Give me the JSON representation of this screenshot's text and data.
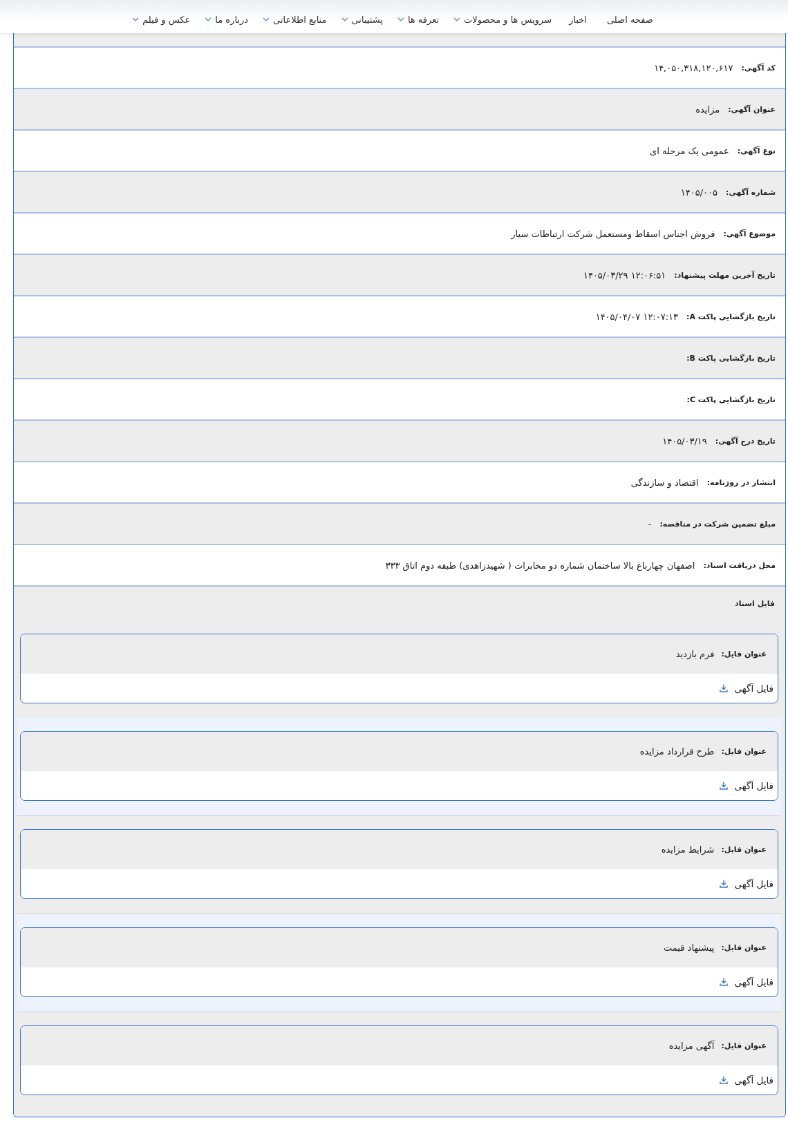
{
  "nav": {
    "items": [
      {
        "label": "صفحه اصلی",
        "kind": "link"
      },
      {
        "label": "اخبار",
        "kind": "link"
      },
      {
        "label": "سرویس ها و محصولات",
        "kind": "menu"
      },
      {
        "label": "تعرفه ها",
        "kind": "menu"
      },
      {
        "label": "پشتیبانی",
        "kind": "menu"
      },
      {
        "label": "منابع اطلاعاتی",
        "kind": "menu"
      },
      {
        "label": "درباره ما",
        "kind": "menu"
      },
      {
        "label": "عکس و فیلم",
        "kind": "menu"
      }
    ]
  },
  "details": {
    "rows": [
      {
        "label": "کد آگهی:",
        "value": "۱۴,۰۵۰,۳۱۸,۱۲۰,۶۱۷"
      },
      {
        "label": "عنوان آگهی:",
        "value": "مزایده"
      },
      {
        "label": "نوع آگهی:",
        "value": "عمومی یک مرحله ای"
      },
      {
        "label": "شماره آگهی:",
        "value": "۱۴۰۵/۰۰۵"
      },
      {
        "label": "موضوع آگهی:",
        "value": "فروش اجناس اسقاط ومستعمل شرکت ارتباطات سیار"
      },
      {
        "label": "تاریخ آخرین مهلت پیشنهاد:",
        "value": "۱۴۰۵/۰۳/۲۹ ۱۲:۰۶:۵۱"
      },
      {
        "label": "تاریخ بازگشایی پاکت A:",
        "value": "۱۴۰۵/۰۴/۰۷ ۱۲:۰۷:۱۳"
      },
      {
        "label": "تاریخ بازگشایی پاکت B:"
      },
      {
        "label": "تاریخ بازگشایی پاکت C:"
      },
      {
        "label": "تاریخ درج آگهی:",
        "value": "۱۴۰۵/۰۳/۱۹"
      },
      {
        "label": "انتشار در روزنامه:",
        "value": "اقتصاد و سازندگی"
      },
      {
        "label": "مبلغ تضمین شرکت در مناقصه:",
        "value": "-"
      },
      {
        "label": "محل دریافت اسناد:",
        "value": "اصفهان چهارباغ بالا ساختمان شماره دو مخابرات ( شهیدزاهدی) طبقه دوم اتاق ۳۳۳"
      }
    ]
  },
  "files": {
    "heading": "فایل اسناد",
    "items": [
      {
        "title_label": "عنوان فایل:",
        "title": "فرم بازدید",
        "link": "فایل آگهی"
      },
      {
        "title_label": "عنوان فایل:",
        "title": "طرح قرارداد مزایده",
        "link": "فایل آگهی"
      },
      {
        "title_label": "عنوان فایل:",
        "title": "شرایط مزایده",
        "link": "فایل آگهی"
      },
      {
        "title_label": "عنوان فایل:",
        "title": "پیشنهاد قیمت",
        "link": "فایل آگهی"
      },
      {
        "title_label": "عنوان فایل:",
        "title": "آگهی مزایده",
        "link": "فایل آگهی"
      }
    ]
  }
}
